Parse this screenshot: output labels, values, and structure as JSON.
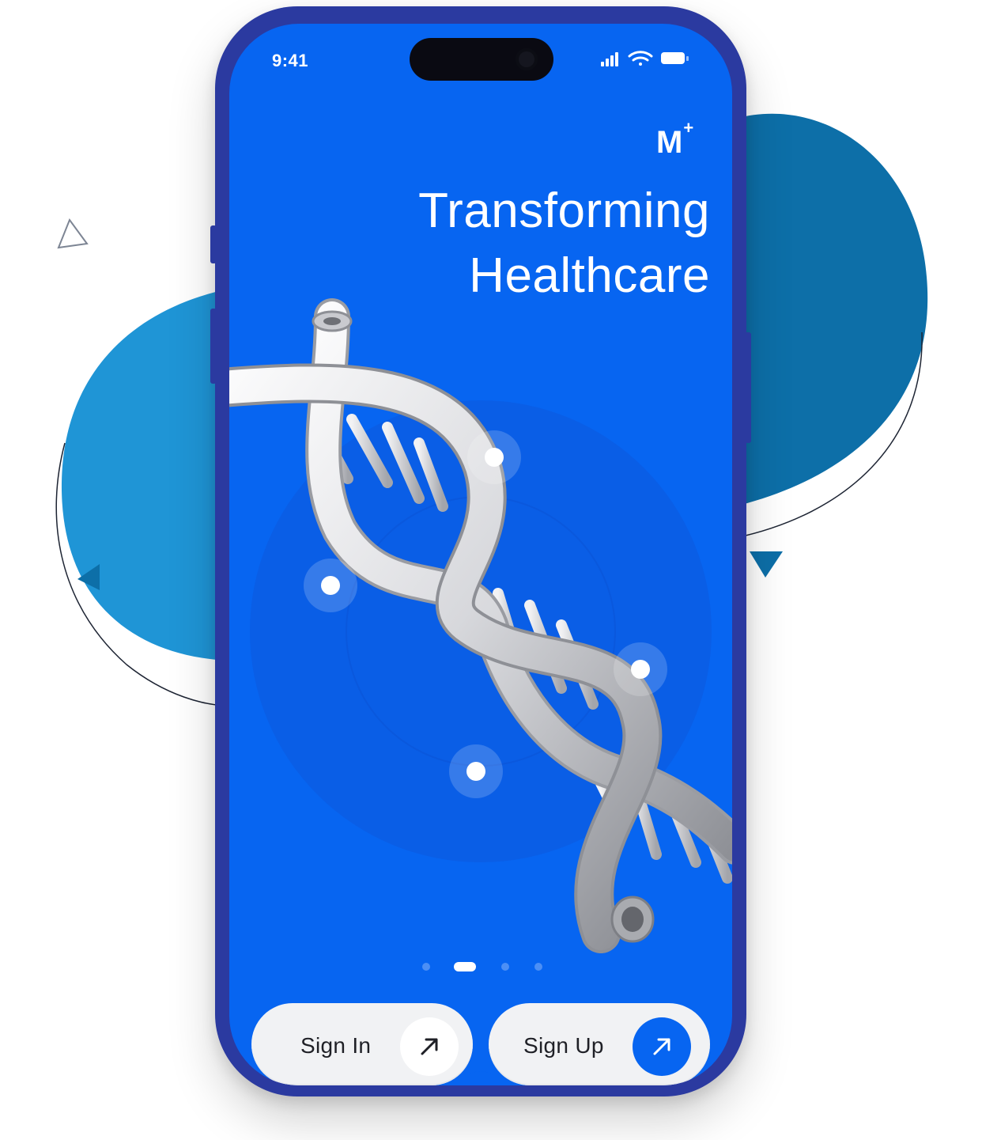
{
  "status_bar": {
    "time": "9:41"
  },
  "brand": {
    "logo_letter": "M",
    "logo_mark": "+"
  },
  "hero": {
    "line1": "Transforming",
    "line2": "Healthcare"
  },
  "pager": {
    "total": 4,
    "active_index": 1
  },
  "actions": {
    "sign_in_label": "Sign In",
    "sign_up_label": "Sign Up"
  },
  "colors": {
    "screen_bg": "#0765f1",
    "accent": "#0765f1",
    "phone_frame": "#2b3aa0",
    "blob_light": "#1f95d6",
    "blob_dark": "#0d6fa8",
    "button_bg": "#f1f2f4"
  },
  "icons": {
    "arrow": "arrow-up-right-icon",
    "signal": "cellular-signal-icon",
    "wifi": "wifi-icon",
    "battery": "battery-icon",
    "camera": "camera-icon"
  }
}
